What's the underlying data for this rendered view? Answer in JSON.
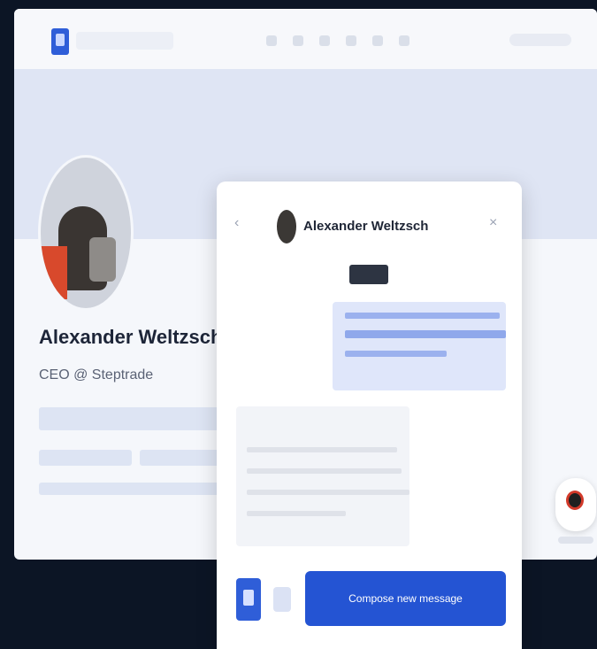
{
  "profile": {
    "name": "Alexander Weltzsch",
    "headline": "CEO @ Steptrade"
  },
  "chat": {
    "contact_name": "Alexander Weltzsch",
    "back_icon": "chevron-left",
    "close_icon": "close",
    "compose_label": "Compose new message"
  },
  "colors": {
    "primary": "#2454d3",
    "background": "#0c1525",
    "outgoing_bubble": "#dfe6fa",
    "incoming_bubble": "#f2f4f8"
  }
}
